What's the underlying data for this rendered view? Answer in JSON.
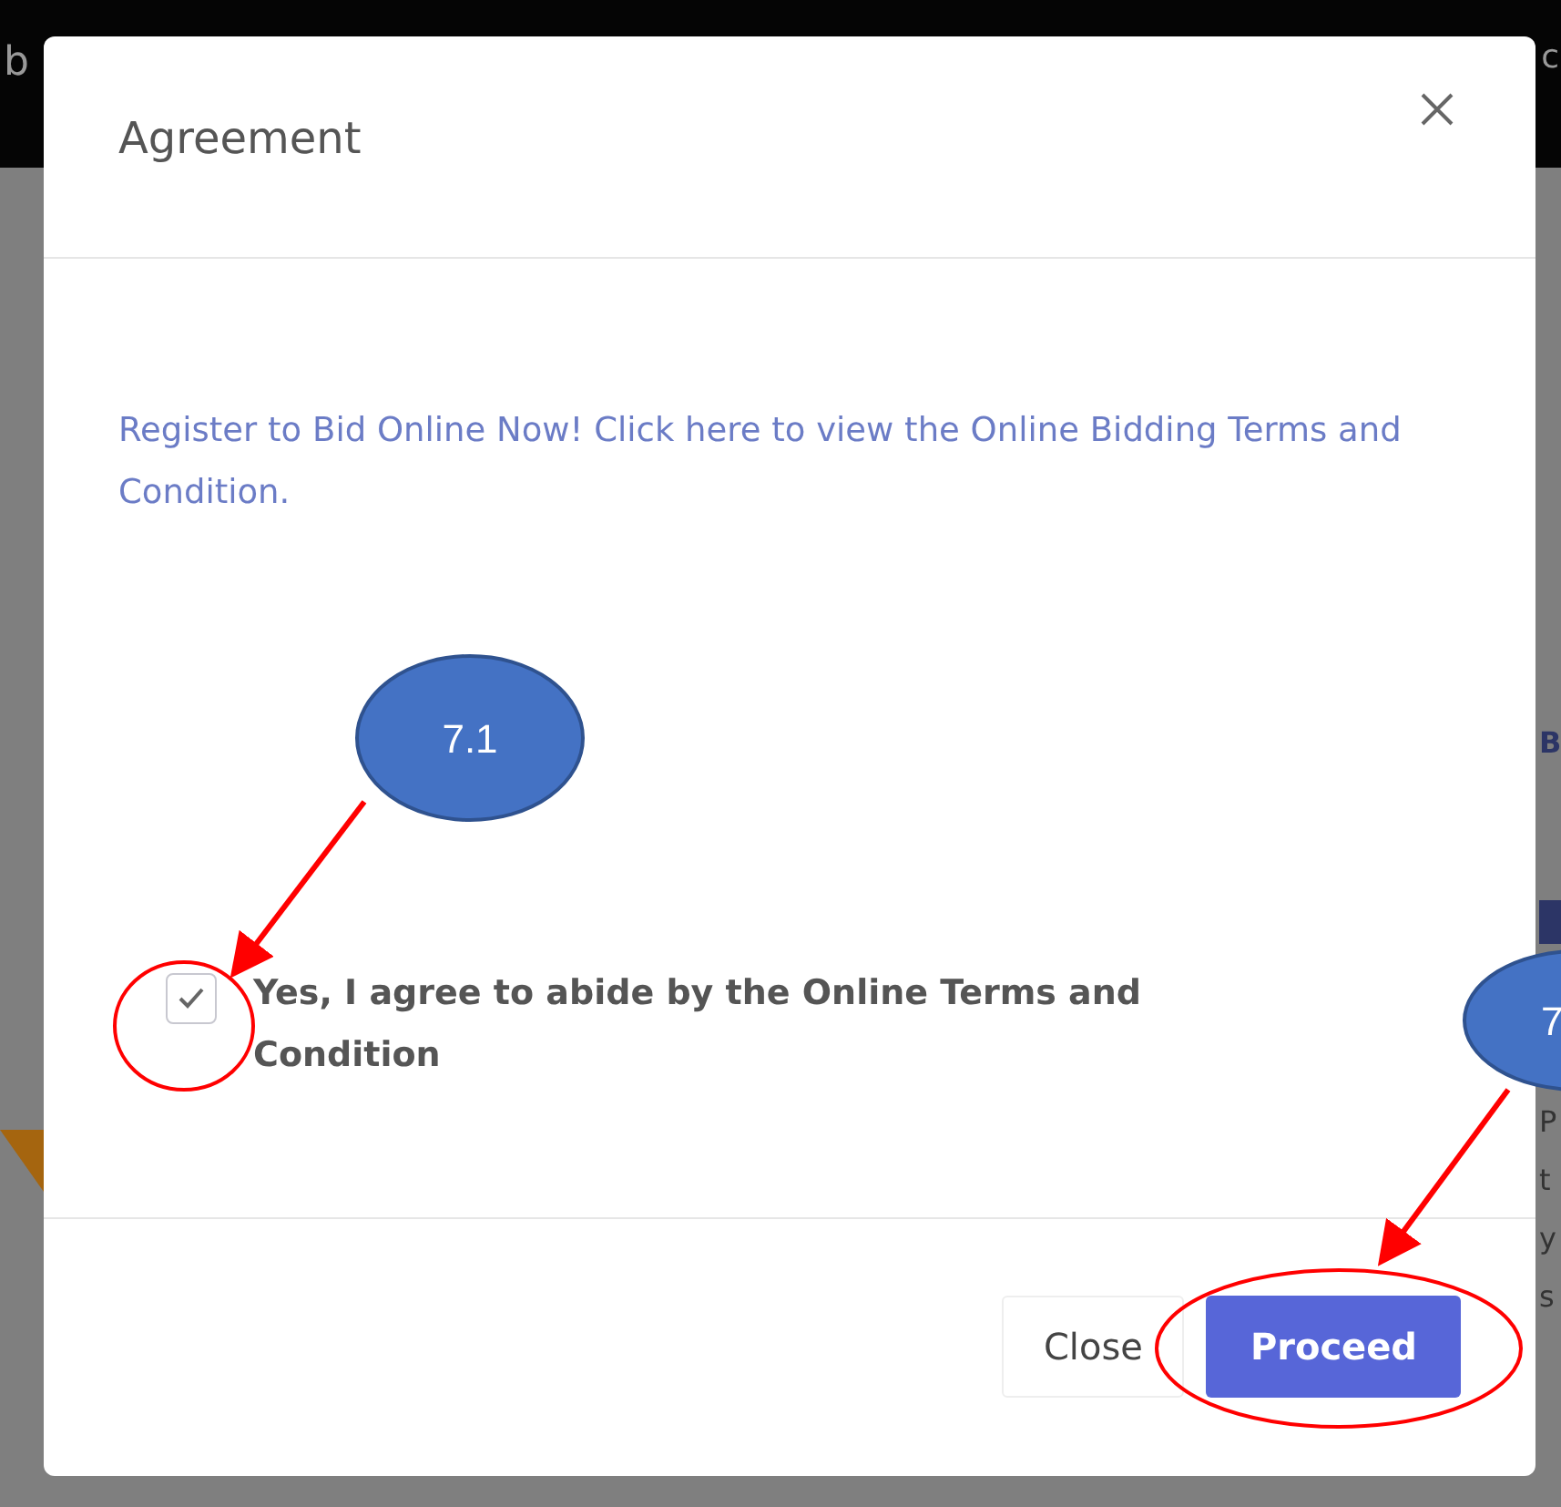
{
  "background": {
    "header_fragments": [
      "b",
      "c"
    ],
    "side_heading": "B",
    "side_lines": [
      "P",
      "t",
      "y",
      "s"
    ]
  },
  "modal": {
    "title": "Agreement",
    "link_text": "Register to Bid Online Now! Click here to view the Online Bidding Terms and Condition.",
    "checkbox": {
      "label": "Yes, I agree to abide by the Online Terms and Condition",
      "checked": true
    },
    "buttons": [
      {
        "label": "Close",
        "kind": "secondary"
      },
      {
        "label": "Proceed",
        "kind": "primary"
      }
    ]
  },
  "annotations": [
    {
      "label": "7.1"
    },
    {
      "label": "7"
    }
  ]
}
